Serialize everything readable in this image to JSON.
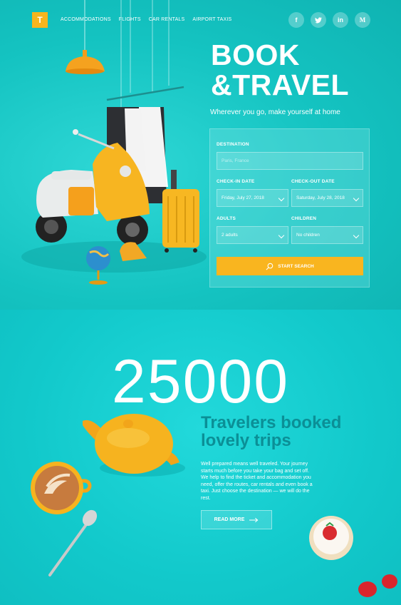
{
  "brand": {
    "logo_letter": "T",
    "accent": "#f7b51d",
    "bg": "#14c3c1"
  },
  "nav": {
    "items": [
      "ACCOMMODATIONS",
      "FLIGHTS",
      "CAR RENTALS",
      "AIRPORT TAXIS"
    ]
  },
  "social": {
    "items": [
      "f",
      "t",
      "in",
      "M"
    ],
    "icons": [
      "facebook-icon",
      "twitter-icon",
      "linkedin-icon",
      "medium-icon"
    ]
  },
  "hero": {
    "title_line1": "BOOK",
    "title_line2": "&TRAVEL",
    "tagline": "Wherever you go, make yourself at home"
  },
  "search_form": {
    "destination_label": "DESTINATION",
    "destination_placeholder": "Paris, France",
    "checkin_label": "CHECK-IN DATE",
    "checkin_value": "Friday, July 27, 2018",
    "checkout_label": "CHECK-OUT DATE",
    "checkout_value": "Saturday, July 28, 2018",
    "adults_label": "ADULTS",
    "adults_value": "2 adults",
    "children_label": "CHILDREN",
    "children_value": "No children",
    "submit_label": "START SEARCH"
  },
  "stats": {
    "number": "25000",
    "title_line1": "Travelers booked",
    "title_line2": "lovely trips",
    "body": "Well prepared means well traveled. Your journey starts much before you take your bag and set off. We help to find the ticket and accommodation you need, offer the routes, car rentals and even book a taxi. Just choose the destination — we will do the rest.",
    "cta_label": "READ MORE"
  }
}
